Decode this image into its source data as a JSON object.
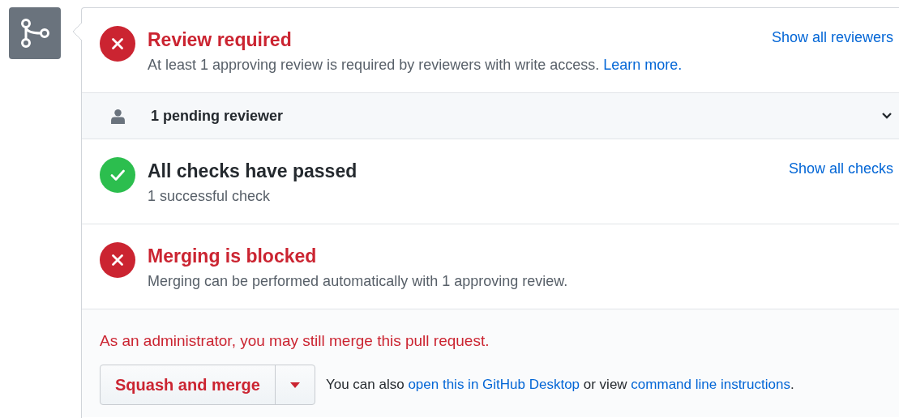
{
  "sections": [
    {
      "kind": "error",
      "title": "Review required",
      "description": [
        {
          "kind": "text",
          "text": "At least 1 approving review is required by reviewers with write access. "
        },
        {
          "kind": "link",
          "text": "Learn more."
        }
      ],
      "action": "Show all reviewers"
    },
    {
      "kind": "reviewers",
      "label": "1 pending reviewer",
      "expanded": false
    },
    {
      "kind": "success",
      "title": "All checks have passed",
      "description": [
        {
          "kind": "text",
          "text": "1 successful check"
        }
      ],
      "action": "Show all checks"
    },
    {
      "kind": "error",
      "title": "Merging is blocked",
      "description": [
        {
          "kind": "text",
          "text": "Merging can be performed automatically with 1 approving review."
        }
      ]
    }
  ],
  "merge": {
    "notice": "As an administrator, you may still merge this pull request.",
    "button": "Squash and merge",
    "hint": [
      {
        "kind": "text",
        "text": "You can also "
      },
      {
        "kind": "link",
        "text": "open this in GitHub Desktop"
      },
      {
        "kind": "text",
        "text": " or view "
      },
      {
        "kind": "link",
        "text": "command line instructions"
      },
      {
        "kind": "text",
        "text": "."
      }
    ]
  }
}
